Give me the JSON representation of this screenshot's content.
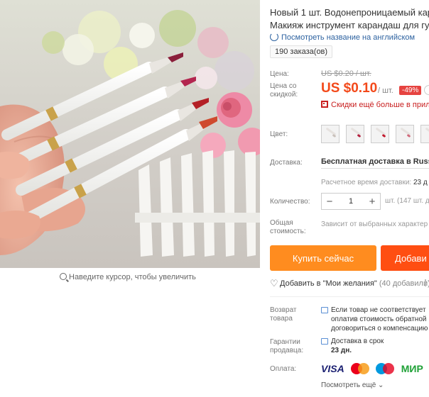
{
  "product": {
    "title_line1": "Новый 1 шт. Водонепроницаемый кар",
    "title_line2": "Макияж инструмент карандаш для губ",
    "translate_link": "Посмотреть название на английском",
    "orders": "190 заказа(ов)"
  },
  "gallery": {
    "zoom_hint": "Наведите курсор, чтобы увеличить"
  },
  "price": {
    "label": "Цена:",
    "old_value": "US $0.20 / шт.",
    "discount_label_line1": "Цена со",
    "discount_label_line2": "скидкой:",
    "value": "US $0.10",
    "unit": "/ шт.",
    "discount_badge": "-49%",
    "app_discount": "Скидки ещё больше в прилож"
  },
  "color": {
    "label": "Цвет:",
    "options": [
      "lip liner 1",
      "lip liner 2",
      "lip liner 3",
      "lip liner 4",
      "lip liner 5"
    ],
    "tip_colors": [
      "#c9c1bb",
      "#b3213f",
      "#c2182c",
      "#d06a7c",
      "#c2534b"
    ]
  },
  "shipping": {
    "label": "Доставка:",
    "value": "Бесплатная доставка в Russian",
    "time_label": "Расчетное время доставки:",
    "time_value": "23 д"
  },
  "quantity": {
    "label": "Количество:",
    "minus": "−",
    "value": "1",
    "plus": "+",
    "stock": "шт. (147 шт. д"
  },
  "total": {
    "label_line1": "Общая",
    "label_line2": "стоимость:",
    "value": "Зависит от выбранных характер"
  },
  "actions": {
    "buy_now": "Купить сейчас",
    "add_to_cart": "Добави"
  },
  "wishlist": {
    "label": "Добавить в \"Мои желания\"",
    "count": "(40 добавили)"
  },
  "returns": {
    "label_line1": "Возврат",
    "label_line2": "товара",
    "text_line1": "Если товар не соответствует",
    "text_line2": "оплатив стоимость обратной",
    "text_line3": "договориться о компенсацию"
  },
  "guarantee": {
    "label_line1": "Гарантии",
    "label_line2": "продавца:",
    "text_line1": "Доставка в срок",
    "text_line2": "23 дн."
  },
  "payment": {
    "label": "Оплата:",
    "methods": [
      "VISA",
      "MasterCard",
      "Maestro",
      "МИР"
    ],
    "more": "Посмотреть ещё"
  }
}
